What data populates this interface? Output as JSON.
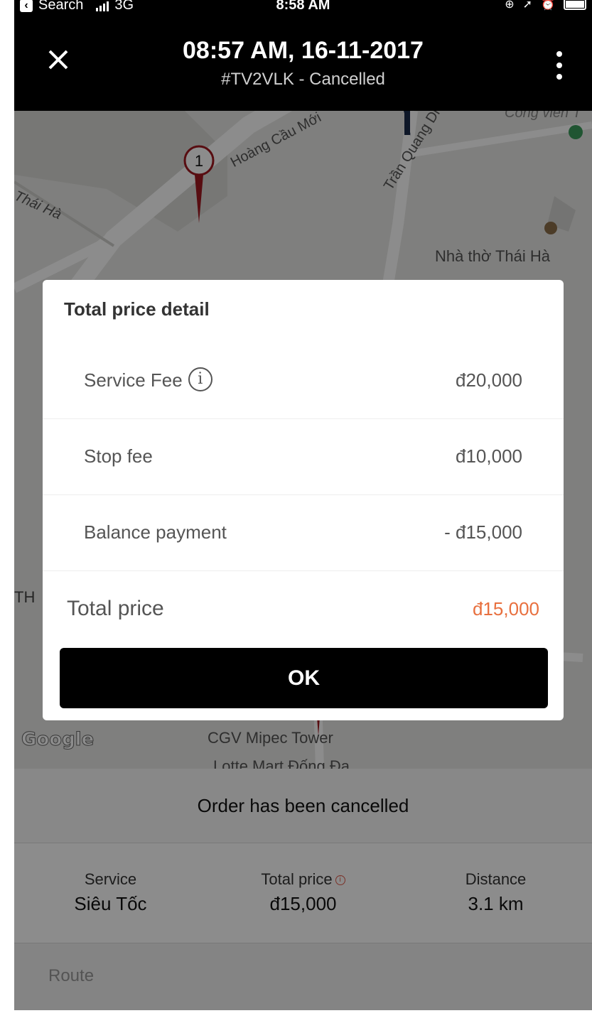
{
  "status_bar": {
    "back_app": "Search",
    "network": "3G",
    "time": "8:58 AM"
  },
  "header": {
    "title": "08:57 AM, 16-11-2017",
    "subtitle": "#TV2VLK - Cancelled",
    "close_icon": "close-icon",
    "more_icon": "more-vertical-icon"
  },
  "map": {
    "labels": {
      "street_1": "Hoàng Cầu Mới",
      "street_2": "Trần Quang Diệu",
      "street_3": "Thái Hà",
      "poi_church": "Nhà thờ Thái Hà",
      "poi_park": "Công viên T",
      "poi_cgv": "CGV Mipec Tower",
      "poi_lotte": "Lotte Mart Đống Đa",
      "left_edge": "TH"
    },
    "marker_number": "1",
    "attribution": "Google"
  },
  "dialog": {
    "title": "Total price detail",
    "rows": [
      {
        "label": "Service Fee",
        "value": "đ20,000"
      },
      {
        "label": "Stop fee",
        "value": "đ10,000"
      },
      {
        "label": "Balance payment",
        "value": "- đ15,000"
      }
    ],
    "total_label": "Total price",
    "total_value": "đ15,000",
    "ok_label": "OK",
    "accent_color": "#e8703f"
  },
  "sheet": {
    "status": "Order has been cancelled",
    "service_label": "Service",
    "service_value": "Siêu Tốc",
    "total_label": "Total price",
    "total_value": "đ15,000",
    "distance_label": "Distance",
    "distance_value": "3.1 km",
    "route_label": "Route"
  }
}
